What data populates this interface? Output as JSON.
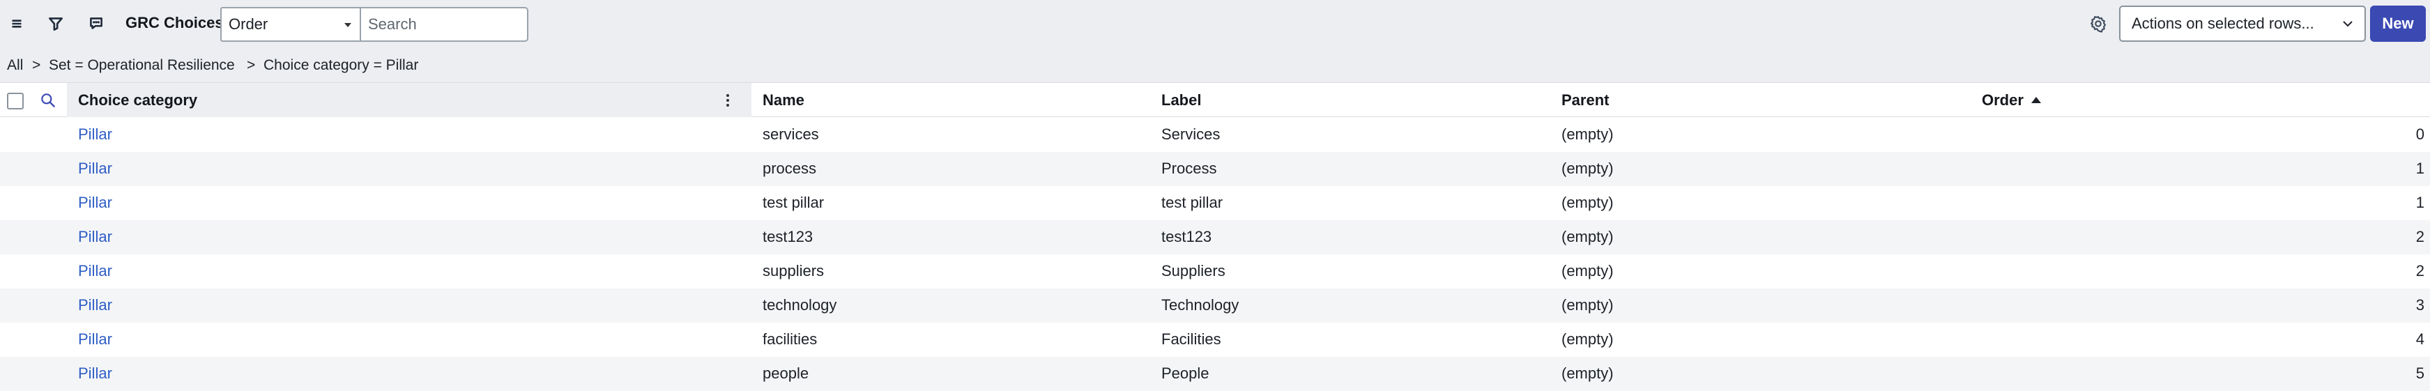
{
  "header": {
    "title": "GRC Choices",
    "field_select": "Order",
    "search_placeholder": "Search",
    "actions_select": "Actions on selected rows...",
    "new_label": "New",
    "icons": [
      "menu-icon",
      "filter-icon",
      "comment-icon",
      "gear-icon"
    ]
  },
  "breadcrumb": {
    "all": "All",
    "sep1": ">",
    "crumb1": "Set = Operational Resilience",
    "sep2": ">",
    "crumb2": "Choice category = Pillar"
  },
  "table": {
    "columns": {
      "choice_category": "Choice category",
      "name": "Name",
      "label": "Label",
      "parent": "Parent",
      "order": "Order"
    },
    "sort": {
      "column": "Order",
      "direction": "ascending"
    },
    "rows": [
      {
        "choice_category": "Pillar",
        "name": "services",
        "label": "Services",
        "parent": "(empty)",
        "order": "0"
      },
      {
        "choice_category": "Pillar",
        "name": "process",
        "label": "Process",
        "parent": "(empty)",
        "order": "1"
      },
      {
        "choice_category": "Pillar",
        "name": "test pillar",
        "label": "test pillar",
        "parent": "(empty)",
        "order": "1"
      },
      {
        "choice_category": "Pillar",
        "name": "test123",
        "label": "test123",
        "parent": "(empty)",
        "order": "2"
      },
      {
        "choice_category": "Pillar",
        "name": "suppliers",
        "label": "Suppliers",
        "parent": "(empty)",
        "order": "2"
      },
      {
        "choice_category": "Pillar",
        "name": "technology",
        "label": "Technology",
        "parent": "(empty)",
        "order": "3"
      },
      {
        "choice_category": "Pillar",
        "name": "facilities",
        "label": "Facilities",
        "parent": "(empty)",
        "order": "4"
      },
      {
        "choice_category": "Pillar",
        "name": "people",
        "label": "People",
        "parent": "(empty)",
        "order": "5"
      }
    ]
  },
  "colors": {
    "link": "#2f5ec6",
    "primary": "#3b49b3",
    "header_bg": "#eceef1",
    "row_alt": "#f4f5f7"
  }
}
